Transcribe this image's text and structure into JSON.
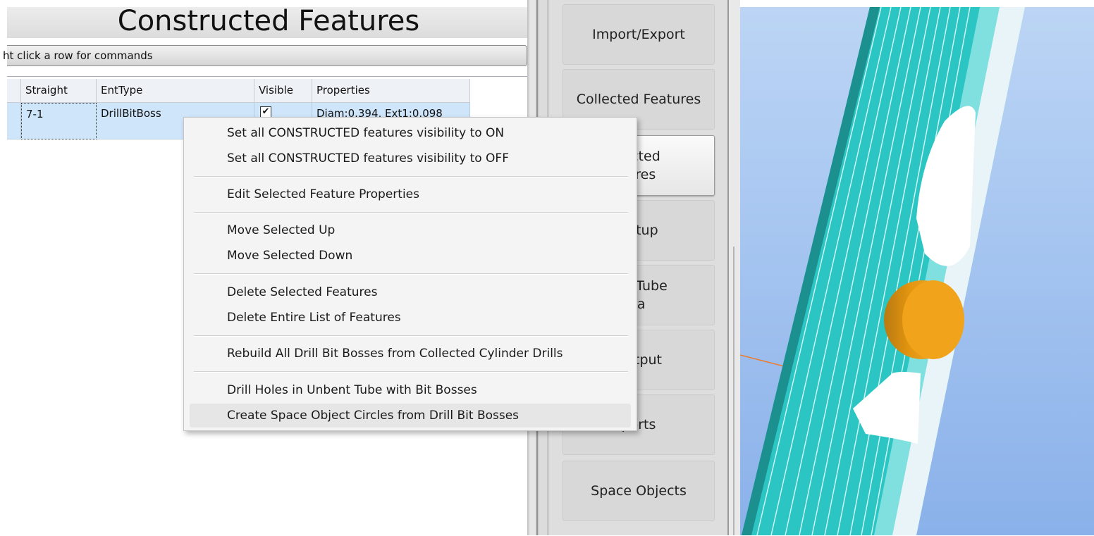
{
  "left_panel": {
    "title": "Constructed Features",
    "hint": "ht click a row for commands",
    "grid": {
      "columns": [
        "Straight",
        "EntType",
        "Visible",
        "Properties"
      ],
      "rows": [
        {
          "straight": "7-1",
          "ent_type": "DrillBitBoss",
          "visible": "✔",
          "properties": "Diam:0.394, Ext1:0.098"
        }
      ]
    }
  },
  "context_menu": {
    "items": [
      "Set all CONSTRUCTED features visibility to ON",
      "Set all CONSTRUCTED features visibility to OFF",
      "Edit Selected Feature Properties",
      "Move Selected Up",
      "Move Selected Down",
      "Delete Selected Features",
      "Delete Entire List of Features",
      "Rebuild All Drill Bit Bosses from Collected Cylinder Drills",
      "Drill Holes in Unbent Tube with Bit Bosses",
      "Create Space Object Circles from Drill Bit Bosses"
    ]
  },
  "nav_panel": {
    "buttons": [
      {
        "line1": "Import/Export",
        "line2": ""
      },
      {
        "line1": "Collected Features",
        "line2": ""
      },
      {
        "line1": "ructed",
        "line2": "tures"
      },
      {
        "line1": "Setup",
        "line2": ""
      },
      {
        "line1": "tric Tube",
        "line2": "ta"
      },
      {
        "line1": "Output",
        "line2": ""
      },
      {
        "line1": "ports",
        "line2": ""
      },
      {
        "line1": "Space Objects",
        "line2": ""
      }
    ],
    "active_index": 2
  },
  "viewport": {
    "tube_color": "#2bc6c4",
    "boss_color": "#f0a21b",
    "background_color": "#a7c5f0"
  }
}
